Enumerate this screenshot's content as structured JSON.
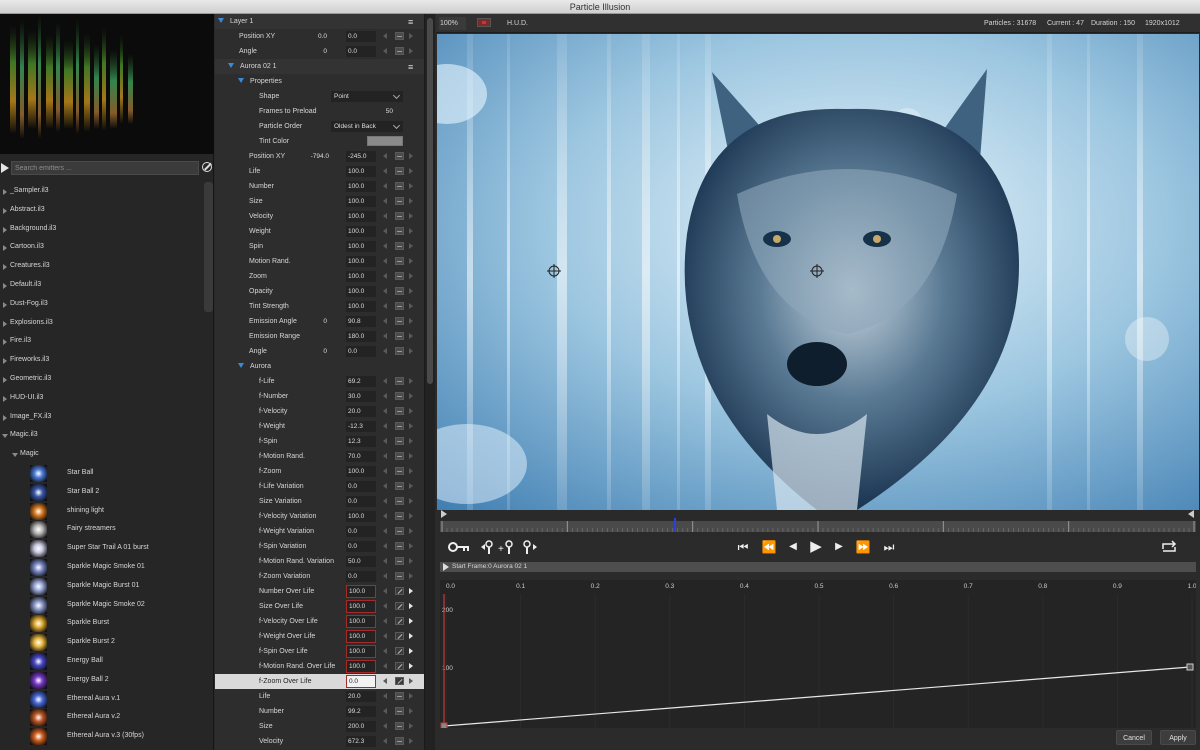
{
  "window": {
    "title": "Particle Illusion"
  },
  "library": {
    "search_placeholder": "Search emitters ...",
    "libraries": [
      "_Sampler.il3",
      "Abstract.il3",
      "Background.il3",
      "Cartoon.il3",
      "Creatures.il3",
      "Default.il3",
      "Dust-Fog.il3",
      "Explosions.il3",
      "Fire.il3",
      "Fireworks.il3",
      "Geometric.il3",
      "HUD-UI.il3",
      "Image_FX.il3",
      "Magic.il3"
    ],
    "open_group": "Magic",
    "emitters": [
      {
        "name": "Star Ball",
        "color": "#4a7ad8"
      },
      {
        "name": "Star Ball 2",
        "color": "#3a58a8"
      },
      {
        "name": "shining light",
        "color": "#d87a20"
      },
      {
        "name": "Fairy streamers",
        "color": "#b8b8b8"
      },
      {
        "name": "Super Star Trail A 01 burst",
        "color": "#c8c8e0"
      },
      {
        "name": "Sparkle Magic Smoke 01",
        "color": "#7a8ac8"
      },
      {
        "name": "Sparkle Magic Burst 01",
        "color": "#9aa8d8"
      },
      {
        "name": "Sparkle Magic Smoke 02",
        "color": "#8a98c8"
      },
      {
        "name": "Sparkle Burst",
        "color": "#e0a830"
      },
      {
        "name": "Sparkle Burst 2",
        "color": "#e8b840"
      },
      {
        "name": "Energy Ball",
        "color": "#4848c8"
      },
      {
        "name": "Energy Ball 2",
        "color": "#7838c8"
      },
      {
        "name": "Ethereal  Aura v.1",
        "color": "#4868d8"
      },
      {
        "name": "Ethereal  Aura v.2",
        "color": "#c05828"
      },
      {
        "name": "Ethereal  Aura v.3 (30fps)",
        "color": "#d06020"
      }
    ]
  },
  "properties": {
    "layer_title": "Layer 1",
    "layer_props": [
      {
        "label": "Position XY",
        "v1": "0.0",
        "v2": "0.0"
      },
      {
        "label": "Angle",
        "v1": "0",
        "v2": "0.0"
      }
    ],
    "emitter_title": "Aurora 02 1",
    "properties_title": "Properties",
    "shape_label": "Shape",
    "shape_value": "Point",
    "frames_label": "Frames to Preload",
    "frames_value": "50",
    "order_label": "Particle Order",
    "order_value": "Oldest in Back",
    "tint_label": "Tint Color",
    "position_label": "Position XY",
    "position_x": "-794.0",
    "position_y": "-245.0",
    "emitter_params": [
      {
        "label": "Life",
        "value": "100.0"
      },
      {
        "label": "Number",
        "value": "100.0"
      },
      {
        "label": "Size",
        "value": "100.0"
      },
      {
        "label": "Velocity",
        "value": "100.0"
      },
      {
        "label": "Weight",
        "value": "100.0"
      },
      {
        "label": "Spin",
        "value": "100.0"
      },
      {
        "label": "Motion Rand.",
        "value": "100.0"
      },
      {
        "label": "Zoom",
        "value": "100.0"
      },
      {
        "label": "Opacity",
        "value": "100.0"
      },
      {
        "label": "Tint Strength",
        "value": "100.0"
      },
      {
        "label": "Emission Angle",
        "v1": "0",
        "value": "90.8"
      },
      {
        "label": "Emission Range",
        "value": "180.0"
      },
      {
        "label": "Angle",
        "v1": "0",
        "value": "0.0"
      }
    ],
    "particle_title": "Aurora",
    "particle_params": [
      {
        "label": "f-Life",
        "value": "69.2"
      },
      {
        "label": "f-Number",
        "value": "30.0"
      },
      {
        "label": "f-Velocity",
        "value": "20.0"
      },
      {
        "label": "f-Weight",
        "value": "-12.3"
      },
      {
        "label": "f-Spin",
        "value": "12.3"
      },
      {
        "label": "f-Motion Rand.",
        "value": "70.0"
      },
      {
        "label": "f-Zoom",
        "value": "100.0"
      },
      {
        "label": "f-Life Variation",
        "value": "0.0"
      },
      {
        "label": "Size Variation",
        "value": "0.0"
      },
      {
        "label": "f-Velocity Variation",
        "value": "100.0"
      },
      {
        "label": "f-Weight Variation",
        "value": "0.0"
      },
      {
        "label": "f-Spin Variation",
        "value": "0.0"
      },
      {
        "label": "f-Motion Rand. Variation",
        "value": "50.0"
      },
      {
        "label": "f-Zoom Variation",
        "value": "0.0"
      }
    ],
    "over_life_params": [
      {
        "label": "Number Over Life",
        "value": "100.0"
      },
      {
        "label": "Size Over Life",
        "value": "100.0"
      },
      {
        "label": "f-Velocity Over Life",
        "value": "100.0"
      },
      {
        "label": "f-Weight Over Life",
        "value": "100.0"
      },
      {
        "label": "f-Spin Over Life",
        "value": "100.0"
      },
      {
        "label": "f-Motion Rand. Over Life",
        "value": "100.0"
      },
      {
        "label": "f-Zoom Over Life",
        "value": "0.0"
      }
    ],
    "tail_params": [
      {
        "label": "Life",
        "value": "20.0"
      },
      {
        "label": "Number",
        "value": "99.2"
      },
      {
        "label": "Size",
        "value": "200.0"
      },
      {
        "label": "Velocity",
        "value": "672.3"
      }
    ]
  },
  "viewer": {
    "zoom": "100%",
    "hud_label": "H.U.D.",
    "particles": "Particles : 31678",
    "current": "Current : 47",
    "duration": "Duration : 150",
    "resolution": "1920x1012"
  },
  "transport_icons": [
    "key-icon",
    "add-key-icon",
    "remove-key-icon",
    "fix-key-icon",
    "go-to-start-icon",
    "rewind-icon",
    "step-back-icon",
    "play-icon",
    "step-forward-icon",
    "fast-forward-icon",
    "go-to-end-icon",
    "loop-icon"
  ],
  "graph": {
    "header": "Start Frame:0 Aurora 02 1",
    "x_ticks": [
      "0.0",
      "0.1",
      "0.2",
      "0.3",
      "0.4",
      "0.5",
      "0.6",
      "0.7",
      "0.8",
      "0.9",
      "1.0"
    ],
    "y_ticks": [
      "200",
      "100"
    ],
    "curve_start": 0,
    "curve_end": 100
  },
  "footer": {
    "cancel": "Cancel",
    "apply": "Apply"
  },
  "colors": {
    "accent": "#3a8ad6",
    "playhead": "#2c3fd8",
    "curve_marker": "#c23a3a",
    "field_outline": "#a52a2a"
  }
}
